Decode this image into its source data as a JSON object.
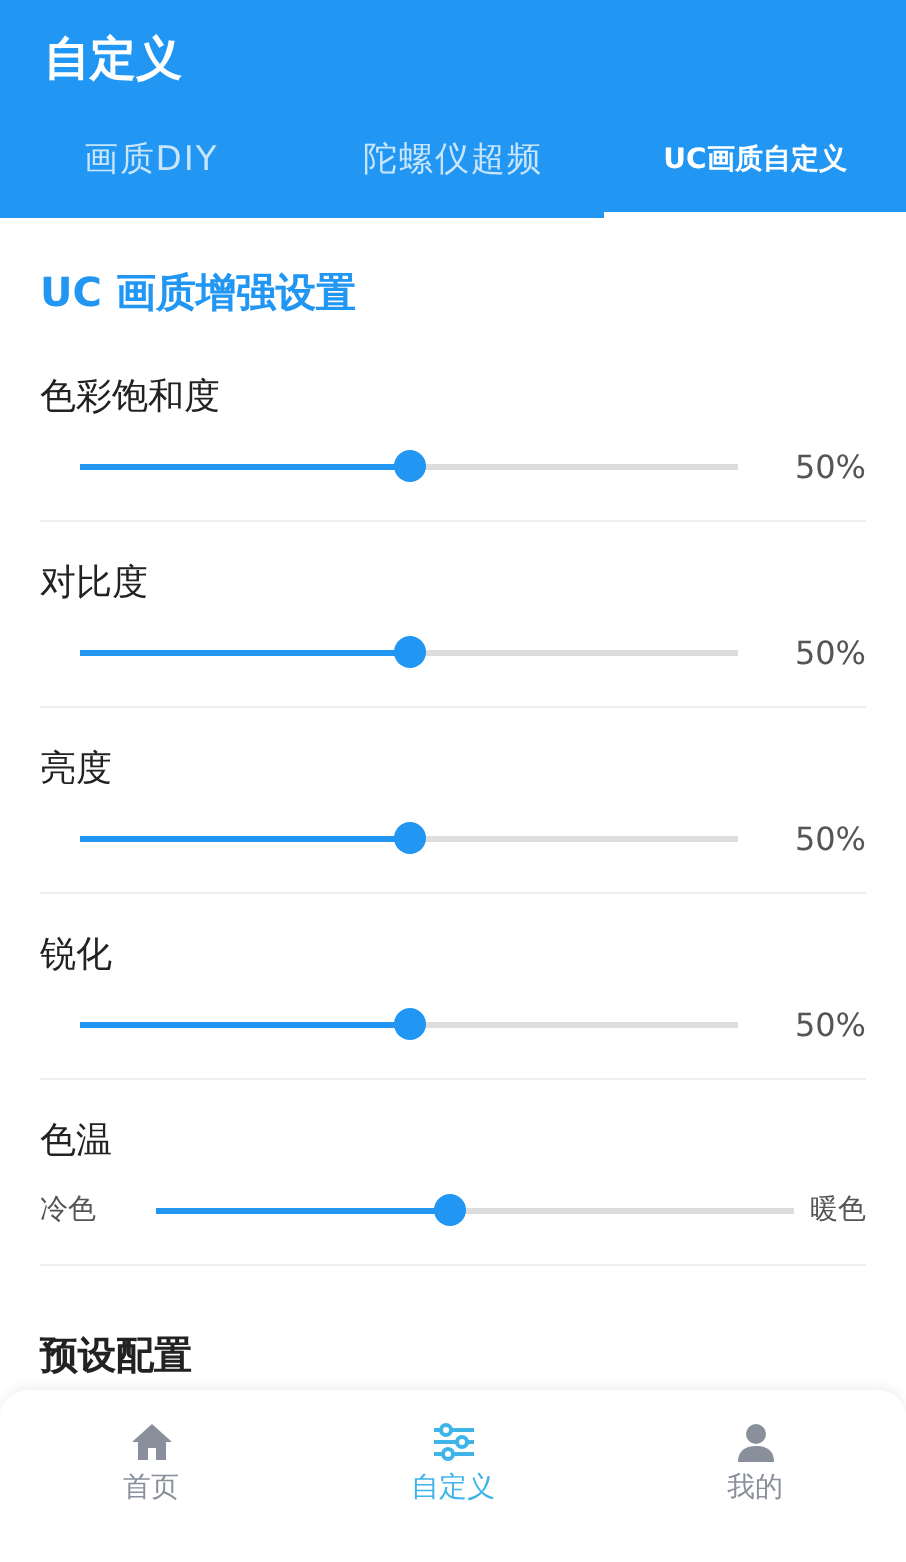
{
  "app_bar": {
    "title": "自定义"
  },
  "tabs": [
    {
      "label": "画质DIY",
      "selected": false
    },
    {
      "label": "陀螺仪超频",
      "selected": false
    },
    {
      "label": "UC画质自定义",
      "selected": true
    }
  ],
  "section": {
    "title": "UC 画质增强设置"
  },
  "settings": [
    {
      "kind": "percent",
      "label": "色彩饱和度",
      "level": 0.5,
      "reading": "50%"
    },
    {
      "kind": "percent",
      "label": "对比度",
      "level": 0.5,
      "reading": "50%"
    },
    {
      "kind": "percent",
      "label": "亮度",
      "level": 0.5,
      "reading": "50%"
    },
    {
      "kind": "percent",
      "label": "锐化",
      "level": 0.5,
      "reading": "50%"
    },
    {
      "kind": "range",
      "label": "色温",
      "level": 0.46,
      "min_label": "冷色",
      "max_label": "暖色"
    }
  ],
  "presets": {
    "title": "预设配置"
  },
  "bottom_nav": [
    {
      "label": "首页",
      "selected": false
    },
    {
      "label": "自定义",
      "selected": true
    },
    {
      "label": "我的",
      "selected": false
    }
  ]
}
